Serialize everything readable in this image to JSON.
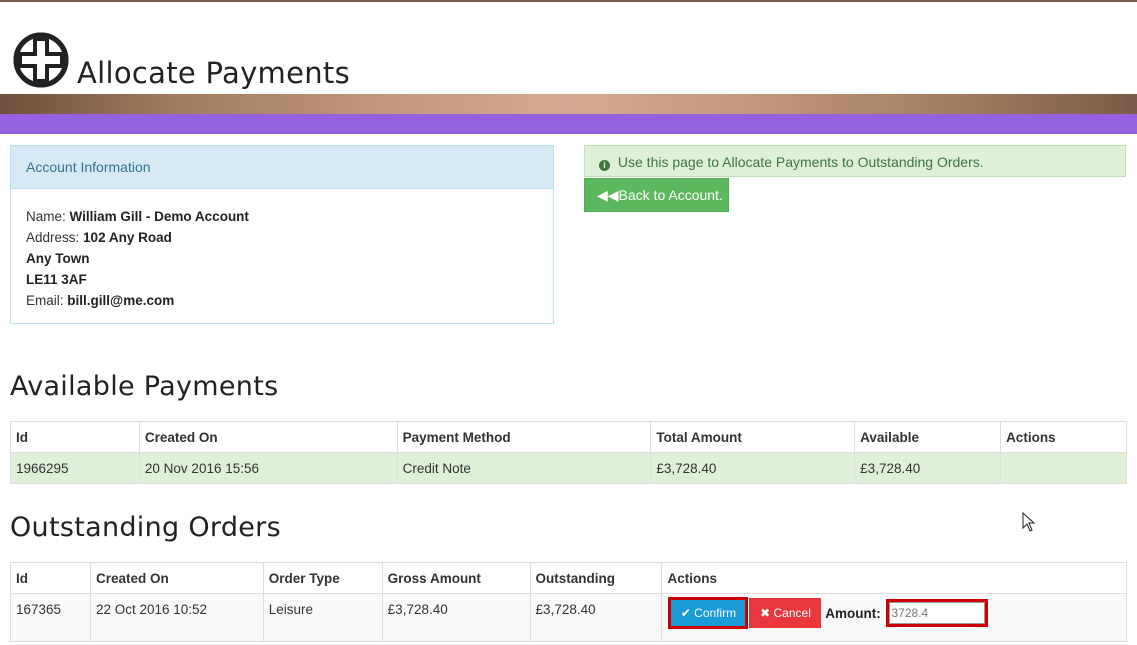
{
  "header": {
    "title": "Allocate Payments"
  },
  "account_panel": {
    "heading": "Account Information",
    "name_label": "Name:",
    "name_value": "William Gill - Demo Account",
    "address_label": "Address:",
    "address_line1": "102 Any Road",
    "address_line2": "Any Town",
    "address_line3": "LE11 3AF",
    "email_label": "Email:",
    "email_value": "bill.gill@me.com"
  },
  "alert": {
    "text": "Use this page to Allocate Payments to Outstanding Orders."
  },
  "back_button": {
    "label": "Back to Account."
  },
  "available_payments": {
    "title": "Available Payments",
    "columns": [
      "Id",
      "Created On",
      "Payment Method",
      "Total Amount",
      "Available",
      "Actions"
    ],
    "rows": [
      [
        "1966295",
        "20 Nov 2016 15:56",
        "Credit Note",
        "£3,728.40",
        "£3,728.40",
        ""
      ]
    ]
  },
  "outstanding_orders": {
    "title": "Outstanding Orders",
    "columns": [
      "Id",
      "Created On",
      "Order Type",
      "Gross Amount",
      "Outstanding",
      "Actions"
    ],
    "rows": [
      [
        "167365",
        "22 Oct 2016 10:52",
        "Leisure",
        "£3,728.40",
        "£3,728.40"
      ]
    ],
    "confirm_label": "Confirm",
    "cancel_label": "Cancel",
    "amount_label": "Amount:",
    "amount_value": "3728.4"
  },
  "colors": {
    "accent_purple": "#9461e0",
    "success_green": "#5cb85c",
    "confirm_blue": "#1a9ad6",
    "cancel_red": "#e8383d",
    "highlight_red": "#cc0000"
  }
}
